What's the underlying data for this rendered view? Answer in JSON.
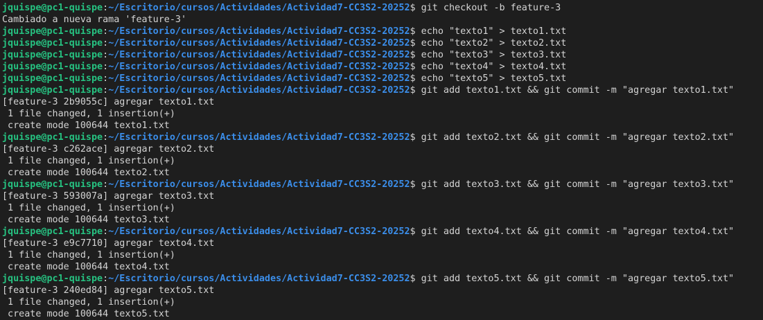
{
  "terminal": {
    "colors": {
      "background": "#1e1e1e",
      "user": "#26c281",
      "path": "#3b8eea",
      "text": "#d4d4d4"
    },
    "lines": [
      {
        "type": "prompt",
        "user": "jquispe@pc1-quispe",
        "sep": ":",
        "path": "~/Escritorio/cursos/Actividades/Actividad7-CC3S2-20252",
        "symbol": "$ ",
        "command": "git checkout -b feature-3"
      },
      {
        "type": "output",
        "text": "Cambiado a nueva rama 'feature-3'"
      },
      {
        "type": "prompt",
        "user": "jquispe@pc1-quispe",
        "sep": ":",
        "path": "~/Escritorio/cursos/Actividades/Actividad7-CC3S2-20252",
        "symbol": "$ ",
        "command": "echo \"texto1\" > texto1.txt"
      },
      {
        "type": "prompt",
        "user": "jquispe@pc1-quispe",
        "sep": ":",
        "path": "~/Escritorio/cursos/Actividades/Actividad7-CC3S2-20252",
        "symbol": "$ ",
        "command": "echo \"texto2\" > texto2.txt"
      },
      {
        "type": "prompt",
        "user": "jquispe@pc1-quispe",
        "sep": ":",
        "path": "~/Escritorio/cursos/Actividades/Actividad7-CC3S2-20252",
        "symbol": "$ ",
        "command": "echo \"texto3\" > texto3.txt"
      },
      {
        "type": "prompt",
        "user": "jquispe@pc1-quispe",
        "sep": ":",
        "path": "~/Escritorio/cursos/Actividades/Actividad7-CC3S2-20252",
        "symbol": "$ ",
        "command": "echo \"texto4\" > texto4.txt"
      },
      {
        "type": "prompt",
        "user": "jquispe@pc1-quispe",
        "sep": ":",
        "path": "~/Escritorio/cursos/Actividades/Actividad7-CC3S2-20252",
        "symbol": "$ ",
        "command": "echo \"texto5\" > texto5.txt"
      },
      {
        "type": "prompt",
        "user": "jquispe@pc1-quispe",
        "sep": ":",
        "path": "~/Escritorio/cursos/Actividades/Actividad7-CC3S2-20252",
        "symbol": "$ ",
        "command": "git add texto1.txt && git commit -m \"agregar texto1.txt\""
      },
      {
        "type": "output",
        "text": "[feature-3 2b9055c] agregar texto1.txt"
      },
      {
        "type": "output",
        "text": " 1 file changed, 1 insertion(+)"
      },
      {
        "type": "output",
        "text": " create mode 100644 texto1.txt"
      },
      {
        "type": "prompt",
        "user": "jquispe@pc1-quispe",
        "sep": ":",
        "path": "~/Escritorio/cursos/Actividades/Actividad7-CC3S2-20252",
        "symbol": "$ ",
        "command": "git add texto2.txt && git commit -m \"agregar texto2.txt\""
      },
      {
        "type": "output",
        "text": "[feature-3 c262ace] agregar texto2.txt"
      },
      {
        "type": "output",
        "text": " 1 file changed, 1 insertion(+)"
      },
      {
        "type": "output",
        "text": " create mode 100644 texto2.txt"
      },
      {
        "type": "prompt",
        "user": "jquispe@pc1-quispe",
        "sep": ":",
        "path": "~/Escritorio/cursos/Actividades/Actividad7-CC3S2-20252",
        "symbol": "$ ",
        "command": "git add texto3.txt && git commit -m \"agregar texto3.txt\""
      },
      {
        "type": "output",
        "text": "[feature-3 593007a] agregar texto3.txt"
      },
      {
        "type": "output",
        "text": " 1 file changed, 1 insertion(+)"
      },
      {
        "type": "output",
        "text": " create mode 100644 texto3.txt"
      },
      {
        "type": "prompt",
        "user": "jquispe@pc1-quispe",
        "sep": ":",
        "path": "~/Escritorio/cursos/Actividades/Actividad7-CC3S2-20252",
        "symbol": "$ ",
        "command": "git add texto4.txt && git commit -m \"agregar texto4.txt\""
      },
      {
        "type": "output",
        "text": "[feature-3 e9c7710] agregar texto4.txt"
      },
      {
        "type": "output",
        "text": " 1 file changed, 1 insertion(+)"
      },
      {
        "type": "output",
        "text": " create mode 100644 texto4.txt"
      },
      {
        "type": "prompt",
        "user": "jquispe@pc1-quispe",
        "sep": ":",
        "path": "~/Escritorio/cursos/Actividades/Actividad7-CC3S2-20252",
        "symbol": "$ ",
        "command": "git add texto5.txt && git commit -m \"agregar texto5.txt\""
      },
      {
        "type": "output",
        "text": "[feature-3 240ed84] agregar texto5.txt"
      },
      {
        "type": "output",
        "text": " 1 file changed, 1 insertion(+)"
      },
      {
        "type": "output",
        "text": " create mode 100644 texto5.txt"
      }
    ]
  }
}
